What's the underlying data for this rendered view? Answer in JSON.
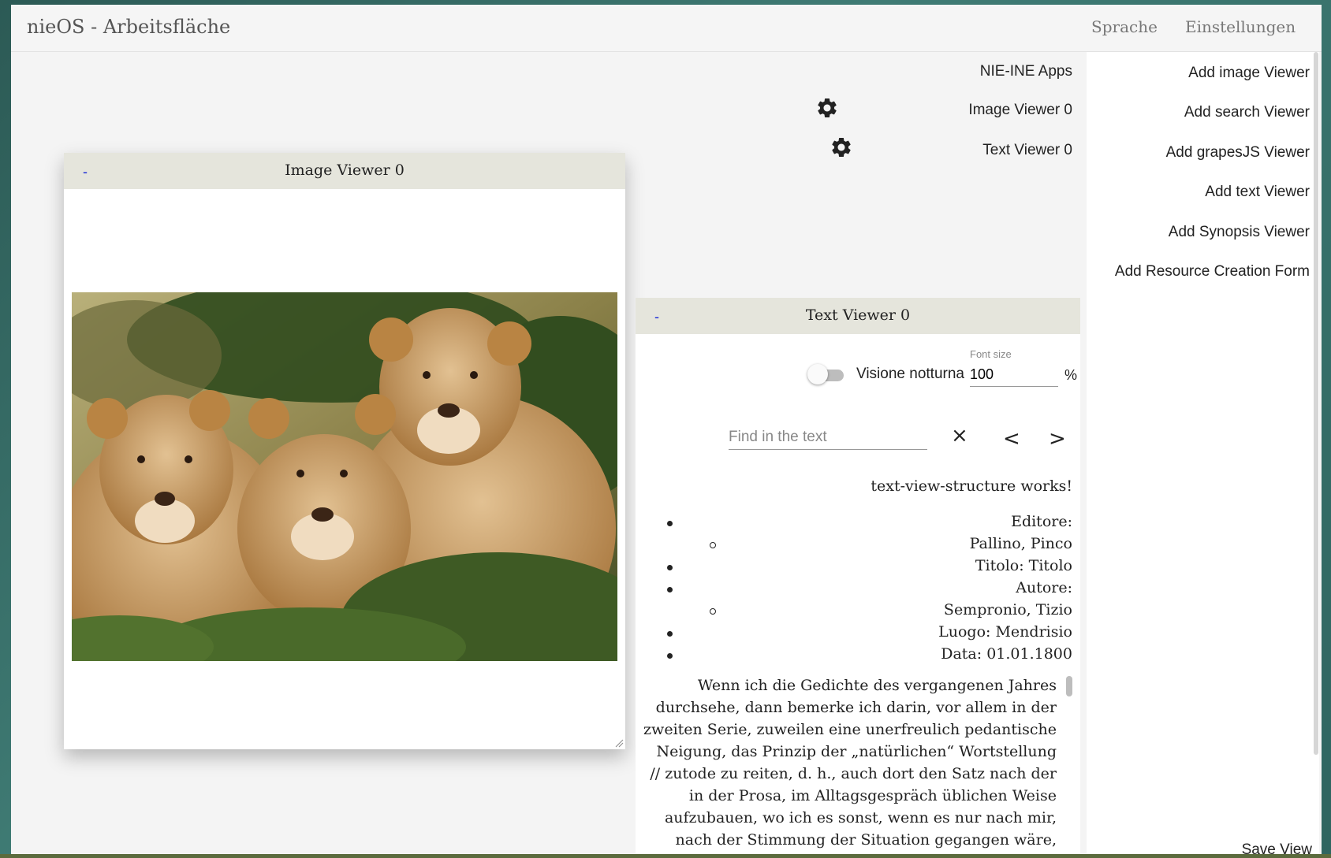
{
  "header": {
    "title": "nieOS - Arbeitsfläche",
    "nav": [
      "Sprache",
      "Einstellungen"
    ]
  },
  "apps": {
    "title": "NIE-INE Apps",
    "items": [
      "Image Viewer 0",
      "Text Viewer 0"
    ],
    "settings_icon": "gear-icon"
  },
  "add_menu": {
    "items": [
      "Add image Viewer",
      "Add search Viewer",
      "Add grapesJS Viewer",
      "Add text Viewer",
      "Add Synopsis Viewer",
      "Add Resource Creation Form"
    ],
    "save_view": "Save View"
  },
  "image_viewer": {
    "title": "Image Viewer 0",
    "minimize": "-"
  },
  "text_viewer": {
    "title": "Text Viewer 0",
    "minimize": "-",
    "night_mode_label": "Visione notturna",
    "font_size_caption": "Font size",
    "font_size_value": "100",
    "font_size_unit": "%",
    "find_placeholder": "Find in the text",
    "status": "text-view-structure works!",
    "metadata": [
      "Editore:",
      "Pallino, Pinco",
      "Titolo: Titolo",
      "Autore:",
      "Sempronio, Tizio",
      "Luogo: Mendrisio",
      "Data: 01.01.1800"
    ],
    "paragraph": "Wenn ich die Gedichte des vergangenen Jahres durchsehe, dann bemerke ich darin, vor allem in der zweiten Serie, zuweilen eine unerfreulich pedantische Neigung, das Prinzip der „natürlichen“ Wortstellung // zutode zu reiten, d. h., auch dort den Satz nach der in der Prosa, im Alltagsgespräch üblichen Weise aufzubauen, wo ich es sonst, wenn es nur nach mir, nach der Stimmung der Situation gegangen wäre, nicht"
  },
  "icons": {
    "clear": "×",
    "prev": "<",
    "next": ">"
  },
  "colors": {
    "window_header": "#e5e5dc",
    "minimize": "#1a2bd6",
    "desktop": "#3f7b74"
  }
}
